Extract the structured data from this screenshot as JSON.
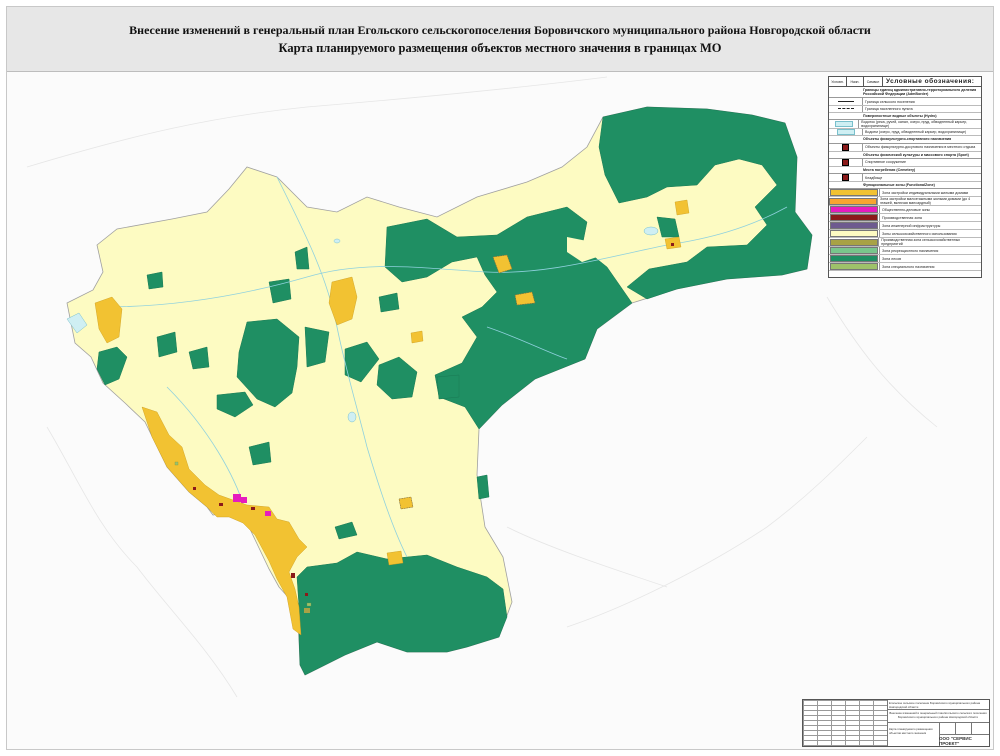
{
  "header": {
    "title_line1": "Внесение изменений в генеральный план Егольского сельскогопоселения Боровичского муниципального района Новгородской области",
    "title_line2": "Карта планируемого размещения объектов местного значения в границах МО"
  },
  "colors": {
    "forest": "#1f8f63",
    "agricultural": "#fdfbc2",
    "residential": "#f2c232",
    "public": "#e61cbe",
    "water": "#cfeff3",
    "production": "#8b1a1a",
    "background": "#fbfbfb"
  },
  "legend": {
    "col_headers": [
      "Условн.",
      "Назн.",
      "Символ"
    ],
    "title": "Условные обозначения:",
    "boundaries_section": "Границы единиц административно-территориального деления Российской Федерации (AdmBorder)",
    "boundary_settlement": "Граница сельского поселения",
    "boundary_locality": "Граница населенного пункта",
    "water_section": "Поверхностные водные объекты (Hydro)",
    "water_courses": "Водоток (река, ручей, канал, озеро, пруд, обводненный карьер, водохранилище)",
    "water_bodies": "Водоем (озеро, пруд, обводненный карьер, водохранилище)",
    "physical_culture_section": "Объекты физкультурно-спортивного назначения",
    "physical_culture_item": "Объекты физкультурно-досугового назначения в местного отдыха",
    "sport_section": "Объекты физической культуры и массового спорта (Sport)",
    "sport_item": "Спортивное сооружение",
    "burial_section": "Места погребения (Cemetery)",
    "burial_item": "Кладбище",
    "zones_section": "Функциональные зоны (FunctionalZone)",
    "zones": [
      {
        "label": "Зона застройки индивидуальными жилыми домами",
        "color": "#f2c232"
      },
      {
        "label": "Зона застройки малоэтажными жилыми домами (до 4 этажей, включая мансардный)",
        "color": "#f7a431"
      },
      {
        "label": "Общественно-деловые зоны",
        "color": "#e61cbe"
      },
      {
        "label": "Производственная зона",
        "color": "#8b1a1a"
      },
      {
        "label": "Зона инженерной инфраструктуры",
        "color": "#6d5a8f"
      },
      {
        "label": "Зоны сельскохозяйственного использования",
        "color": "#fdfbc2"
      },
      {
        "label": "Производственная зона сельскохозяйственных предприятий",
        "color": "#a8a245"
      },
      {
        "label": "Зона рекреационного назначения",
        "color": "#79c68c"
      },
      {
        "label": "Зона лесов",
        "color": "#1f8f63"
      },
      {
        "label": "Зона специального назначения",
        "color": "#9ec26a"
      }
    ]
  },
  "stamp": {
    "row1": "Егольское сельское поселение Боровичского муниципального района Новгородской области",
    "row2": "Внесение изменений в генеральный план Егольского сельского поселения Боровичского муниципального района Новгородской области",
    "row3": "Карта планируемого размещения объектов местного значения",
    "company": "ООО \"СЕРВИС ПРОЕКТ\""
  }
}
